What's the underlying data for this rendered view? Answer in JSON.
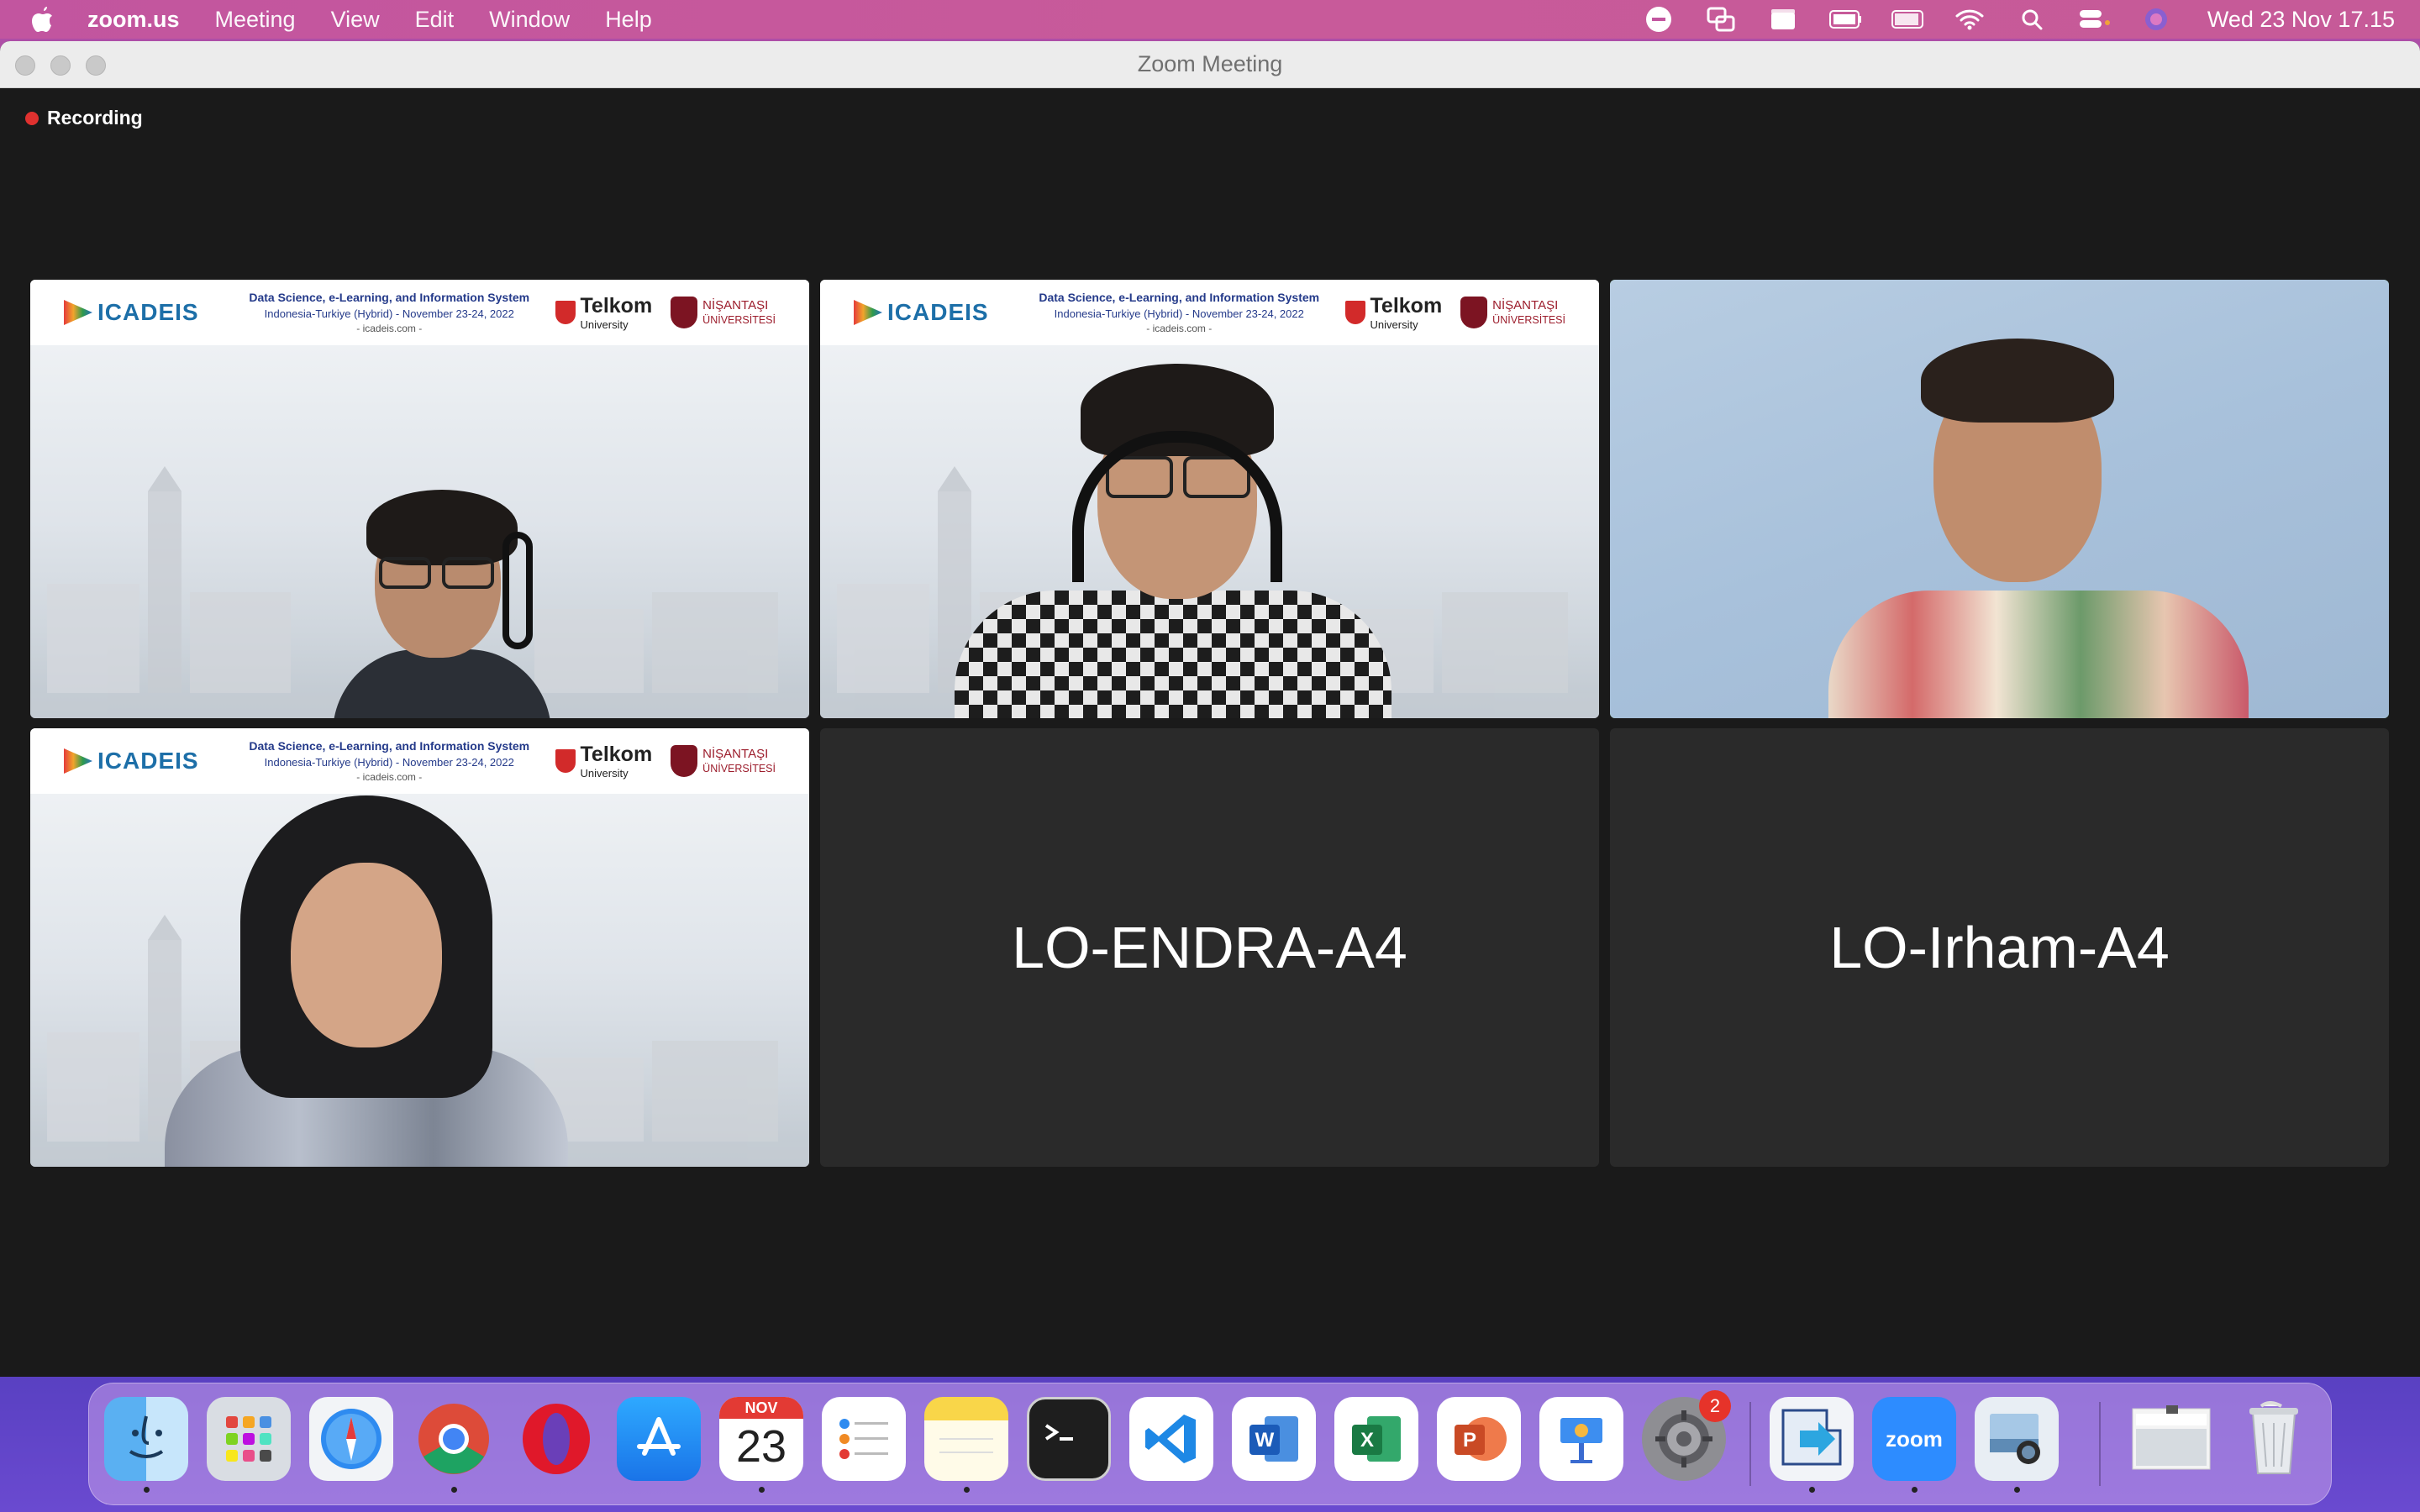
{
  "menubar": {
    "app_name": "zoom.us",
    "menus": [
      "Meeting",
      "View",
      "Edit",
      "Window",
      "Help"
    ],
    "clock": "Wed 23 Nov  17.15",
    "status_icons": [
      "stop-icon",
      "screen-mirror-icon",
      "clapper-icon",
      "battery-ext-icon",
      "battery-icon",
      "wifi-icon",
      "search-icon",
      "control-center-icon",
      "siri-icon"
    ]
  },
  "window": {
    "title": "Zoom Meeting",
    "recording_label": "Recording"
  },
  "banner": {
    "logo": "ICADEIS",
    "line1": "Data Science, e-Learning, and Information System",
    "line2": "Indonesia-Turkiye (Hybrid) - November 23-24, 2022",
    "line3": "- icadeis.com -",
    "telkom": "Telkom",
    "telkom_sub": "University",
    "nisantasi": "NİŞANTAŞI",
    "nisantasi_sub": "ÜNİVERSİTESİ"
  },
  "participants": [
    {
      "type": "video",
      "background": "virtual"
    },
    {
      "type": "video",
      "background": "virtual"
    },
    {
      "type": "video",
      "background": "plain",
      "active_speaker": true
    },
    {
      "type": "video",
      "background": "virtual"
    },
    {
      "type": "name",
      "name": "LO-ENDRA-A4"
    },
    {
      "type": "name",
      "name": "LO-Irham-A4"
    }
  ],
  "dock": {
    "calendar_month": "NOV",
    "calendar_day": "23",
    "settings_badge": "2",
    "zoom_label": "zoom",
    "items": [
      "finder-icon",
      "launchpad-icon",
      "safari-icon",
      "chrome-icon",
      "opera-icon",
      "app-store-icon",
      "calendar-icon",
      "reminders-icon",
      "notes-icon",
      "terminal-icon",
      "vscode-icon",
      "word-icon",
      "excel-icon",
      "powerpoint-icon",
      "keynote-icon",
      "system-settings-icon",
      "transfer-icon",
      "zoom-icon",
      "preview-icon",
      "recent-window-icon",
      "trash-icon"
    ]
  },
  "colors": {
    "active_speaker": "#5fd14a",
    "recording_dot": "#e0312f",
    "tile_bg": "#2a2a2a"
  }
}
